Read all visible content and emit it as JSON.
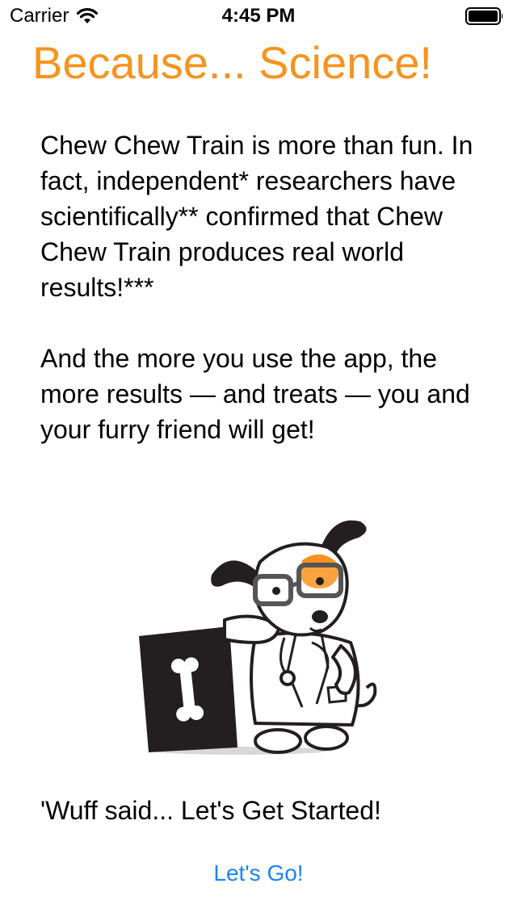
{
  "status_bar": {
    "carrier": "Carrier",
    "time": "4:45 PM",
    "wifi_icon": "wifi-icon",
    "battery_icon": "battery-icon"
  },
  "page": {
    "title": "Because... Science!",
    "paragraph_1": "Chew Chew Train is more than fun. In fact, independent* researchers have scientifically** confirmed that Chew Chew Train produces real world results!***",
    "paragraph_2": "And the more you use the app, the more results — and treats — you and your furry friend will get!",
    "tagline": "'Wuff said... Let's Get Started!",
    "illustration_icon": "scientist-dog-illustration"
  },
  "actions": {
    "go_label": "Let's Go!"
  },
  "colors": {
    "title": "#F7931E",
    "button": "#1A82FB",
    "dog_patch": "#F7931E",
    "dark": "#231F20"
  }
}
